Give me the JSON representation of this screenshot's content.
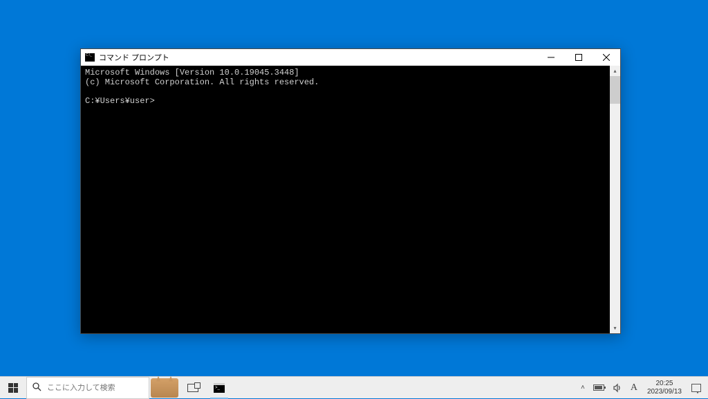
{
  "window": {
    "title": "コマンド プロンプト",
    "console": {
      "line1": "Microsoft Windows [Version 10.0.19045.3448]",
      "line2": "(c) Microsoft Corporation. All rights reserved.",
      "blank": "",
      "prompt": "C:¥Users¥user>"
    }
  },
  "taskbar": {
    "search": {
      "placeholder": "ここに入力して検索"
    },
    "tray": {
      "caret": "˄",
      "ime": "A",
      "time": "20:25",
      "date": "2023/09/13"
    }
  }
}
